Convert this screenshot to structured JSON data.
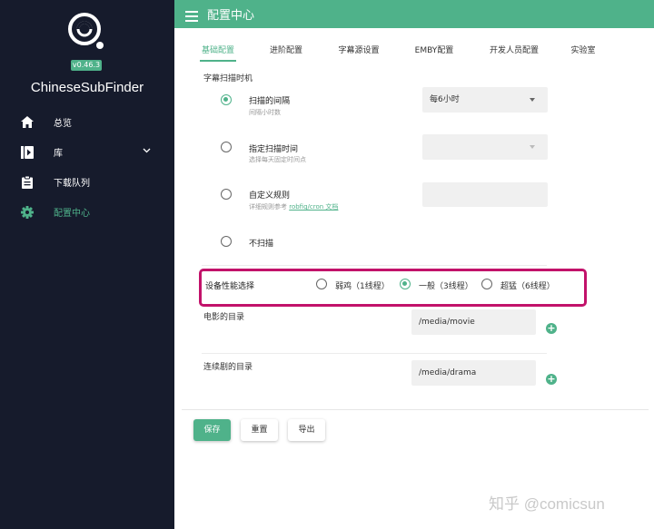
{
  "app": {
    "name": "ChineseSubFinder",
    "version": "v0.46.3"
  },
  "sidebar": {
    "items": [
      {
        "label": "总览",
        "icon": "home-icon"
      },
      {
        "label": "库",
        "icon": "library-play-icon"
      },
      {
        "label": "下载队列",
        "icon": "clipboard-icon"
      },
      {
        "label": "配置中心",
        "icon": "gear-icon"
      }
    ]
  },
  "header": {
    "title": "配置中心"
  },
  "tabs": [
    "基础配置",
    "进阶配置",
    "字幕源设置",
    "EMBY配置",
    "开发人员配置",
    "实验室"
  ],
  "scan": {
    "section_label": "字幕扫描时机",
    "options": [
      {
        "title": "扫描的间隔",
        "subtitle": "间隔小时数",
        "checked": true
      },
      {
        "title": "指定扫描时间",
        "subtitle": "选择每天固定时间点",
        "checked": false
      },
      {
        "title": "自定义规则",
        "subtitle_prefix": "详细规则参考",
        "link_text": "robfig/cron 文档",
        "checked": false
      },
      {
        "title": "不扫描",
        "checked": false
      }
    ],
    "interval_select_value": "每6小时"
  },
  "performance": {
    "label": "设备性能选择",
    "options": [
      {
        "label": "弱鸡（1线程）",
        "checked": false
      },
      {
        "label": "一般（3线程）",
        "checked": true
      },
      {
        "label": "超猛（6线程）",
        "checked": false
      }
    ]
  },
  "dirs": {
    "movie_label": "电影的目录",
    "movie_value": "/media/movie",
    "drama_label": "连续剧的目录",
    "drama_value": "/media/drama"
  },
  "buttons": {
    "save": "保存",
    "reset": "重置",
    "export": "导出"
  },
  "watermark": "知乎 @comicsun",
  "colors": {
    "accent": "#4fb28a",
    "sidebar_bg": "#161b2c",
    "highlight": "#c2126a"
  }
}
